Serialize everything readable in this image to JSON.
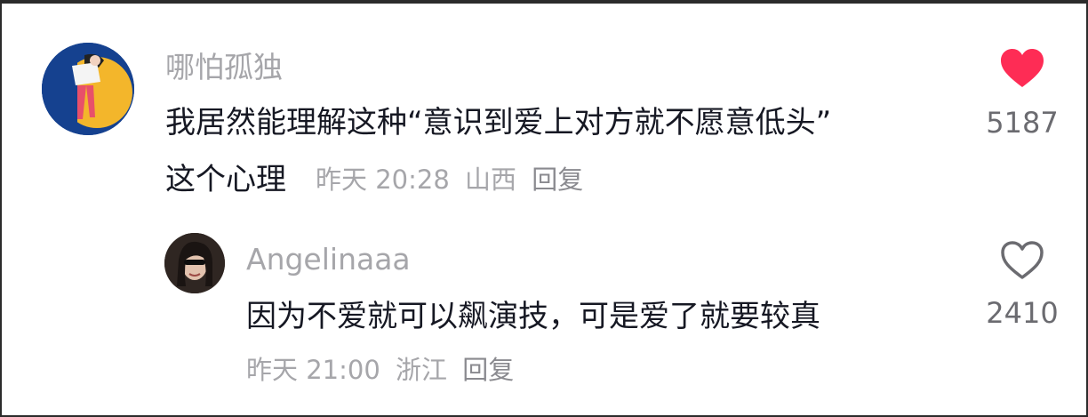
{
  "comments": [
    {
      "username": "哪怕孤独",
      "text_line1": "我居然能理解这种“意识到爱上对方就不愿意低头”",
      "text_line2": "这个心理",
      "time": "昨天 20:28",
      "location": "山西",
      "reply_label": "回复",
      "like_count": "5187",
      "liked": true,
      "like_color": "#fe2c55"
    },
    {
      "username": "Angelinaaa",
      "text_line1": "因为不爱就可以飙演技，可是爱了就要较真",
      "time": "昨天 21:00",
      "location": "浙江",
      "reply_label": "回复",
      "like_count": "2410",
      "liked": false
    }
  ]
}
